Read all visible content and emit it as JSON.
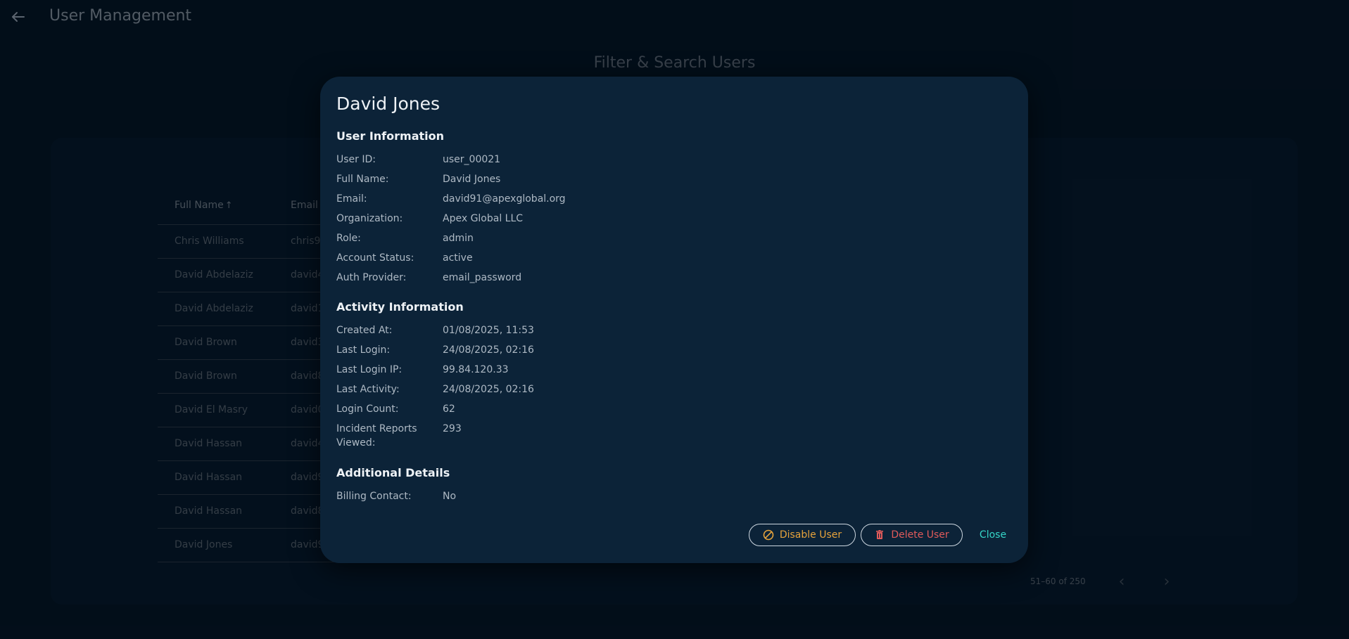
{
  "header": {
    "title": "User Management",
    "back_icon": "arrow-left-icon"
  },
  "section_title": "Filter & Search Users",
  "table": {
    "columns": [
      "Full Name",
      "Email"
    ],
    "sort_icon": "arrow-up-icon",
    "rows": [
      {
        "name": "Chris Williams",
        "email": "chris9"
      },
      {
        "name": "David Abdelaziz",
        "email": "david4"
      },
      {
        "name": "David Abdelaziz",
        "email": "david1"
      },
      {
        "name": "David Brown",
        "email": "david3"
      },
      {
        "name": "David Brown",
        "email": "david8"
      },
      {
        "name": "David El Masry",
        "email": "david0"
      },
      {
        "name": "David Hassan",
        "email": "david4"
      },
      {
        "name": "David Hassan",
        "email": "david9"
      },
      {
        "name": "David Hassan",
        "email": "david8"
      },
      {
        "name": "David Jones",
        "email": "david9"
      }
    ]
  },
  "pagination": {
    "range": "51–60 of 250"
  },
  "modal": {
    "title": "David Jones",
    "user_info": {
      "heading": "User Information",
      "fields": [
        {
          "label": "User ID:",
          "value": "user_00021"
        },
        {
          "label": "Full Name:",
          "value": "David Jones"
        },
        {
          "label": "Email:",
          "value": "david91@apexglobal.org"
        },
        {
          "label": "Organization:",
          "value": "Apex Global LLC"
        },
        {
          "label": "Role:",
          "value": "admin"
        },
        {
          "label": "Account Status:",
          "value": "active"
        },
        {
          "label": "Auth Provider:",
          "value": "email_password"
        }
      ]
    },
    "activity_info": {
      "heading": "Activity Information",
      "fields": [
        {
          "label": "Created At:",
          "value": "01/08/2025, 11:53"
        },
        {
          "label": "Last Login:",
          "value": "24/08/2025, 02:16"
        },
        {
          "label": "Last Login IP:",
          "value": "99.84.120.33"
        },
        {
          "label": "Last Activity:",
          "value": "24/08/2025, 02:16"
        },
        {
          "label": "Login Count:",
          "value": "62"
        },
        {
          "label": "Incident Reports Viewed:",
          "value": "293"
        }
      ]
    },
    "additional": {
      "heading": "Additional Details",
      "fields": [
        {
          "label": "Billing Contact:",
          "value": "No"
        }
      ]
    },
    "buttons": {
      "disable": "Disable User",
      "delete": "Delete User",
      "close": "Close"
    }
  },
  "colors": {
    "background": "#041422",
    "modal": "#0c2338",
    "disable": "#e6a33c",
    "delete": "#e05a5a",
    "close": "#35d5c8"
  }
}
